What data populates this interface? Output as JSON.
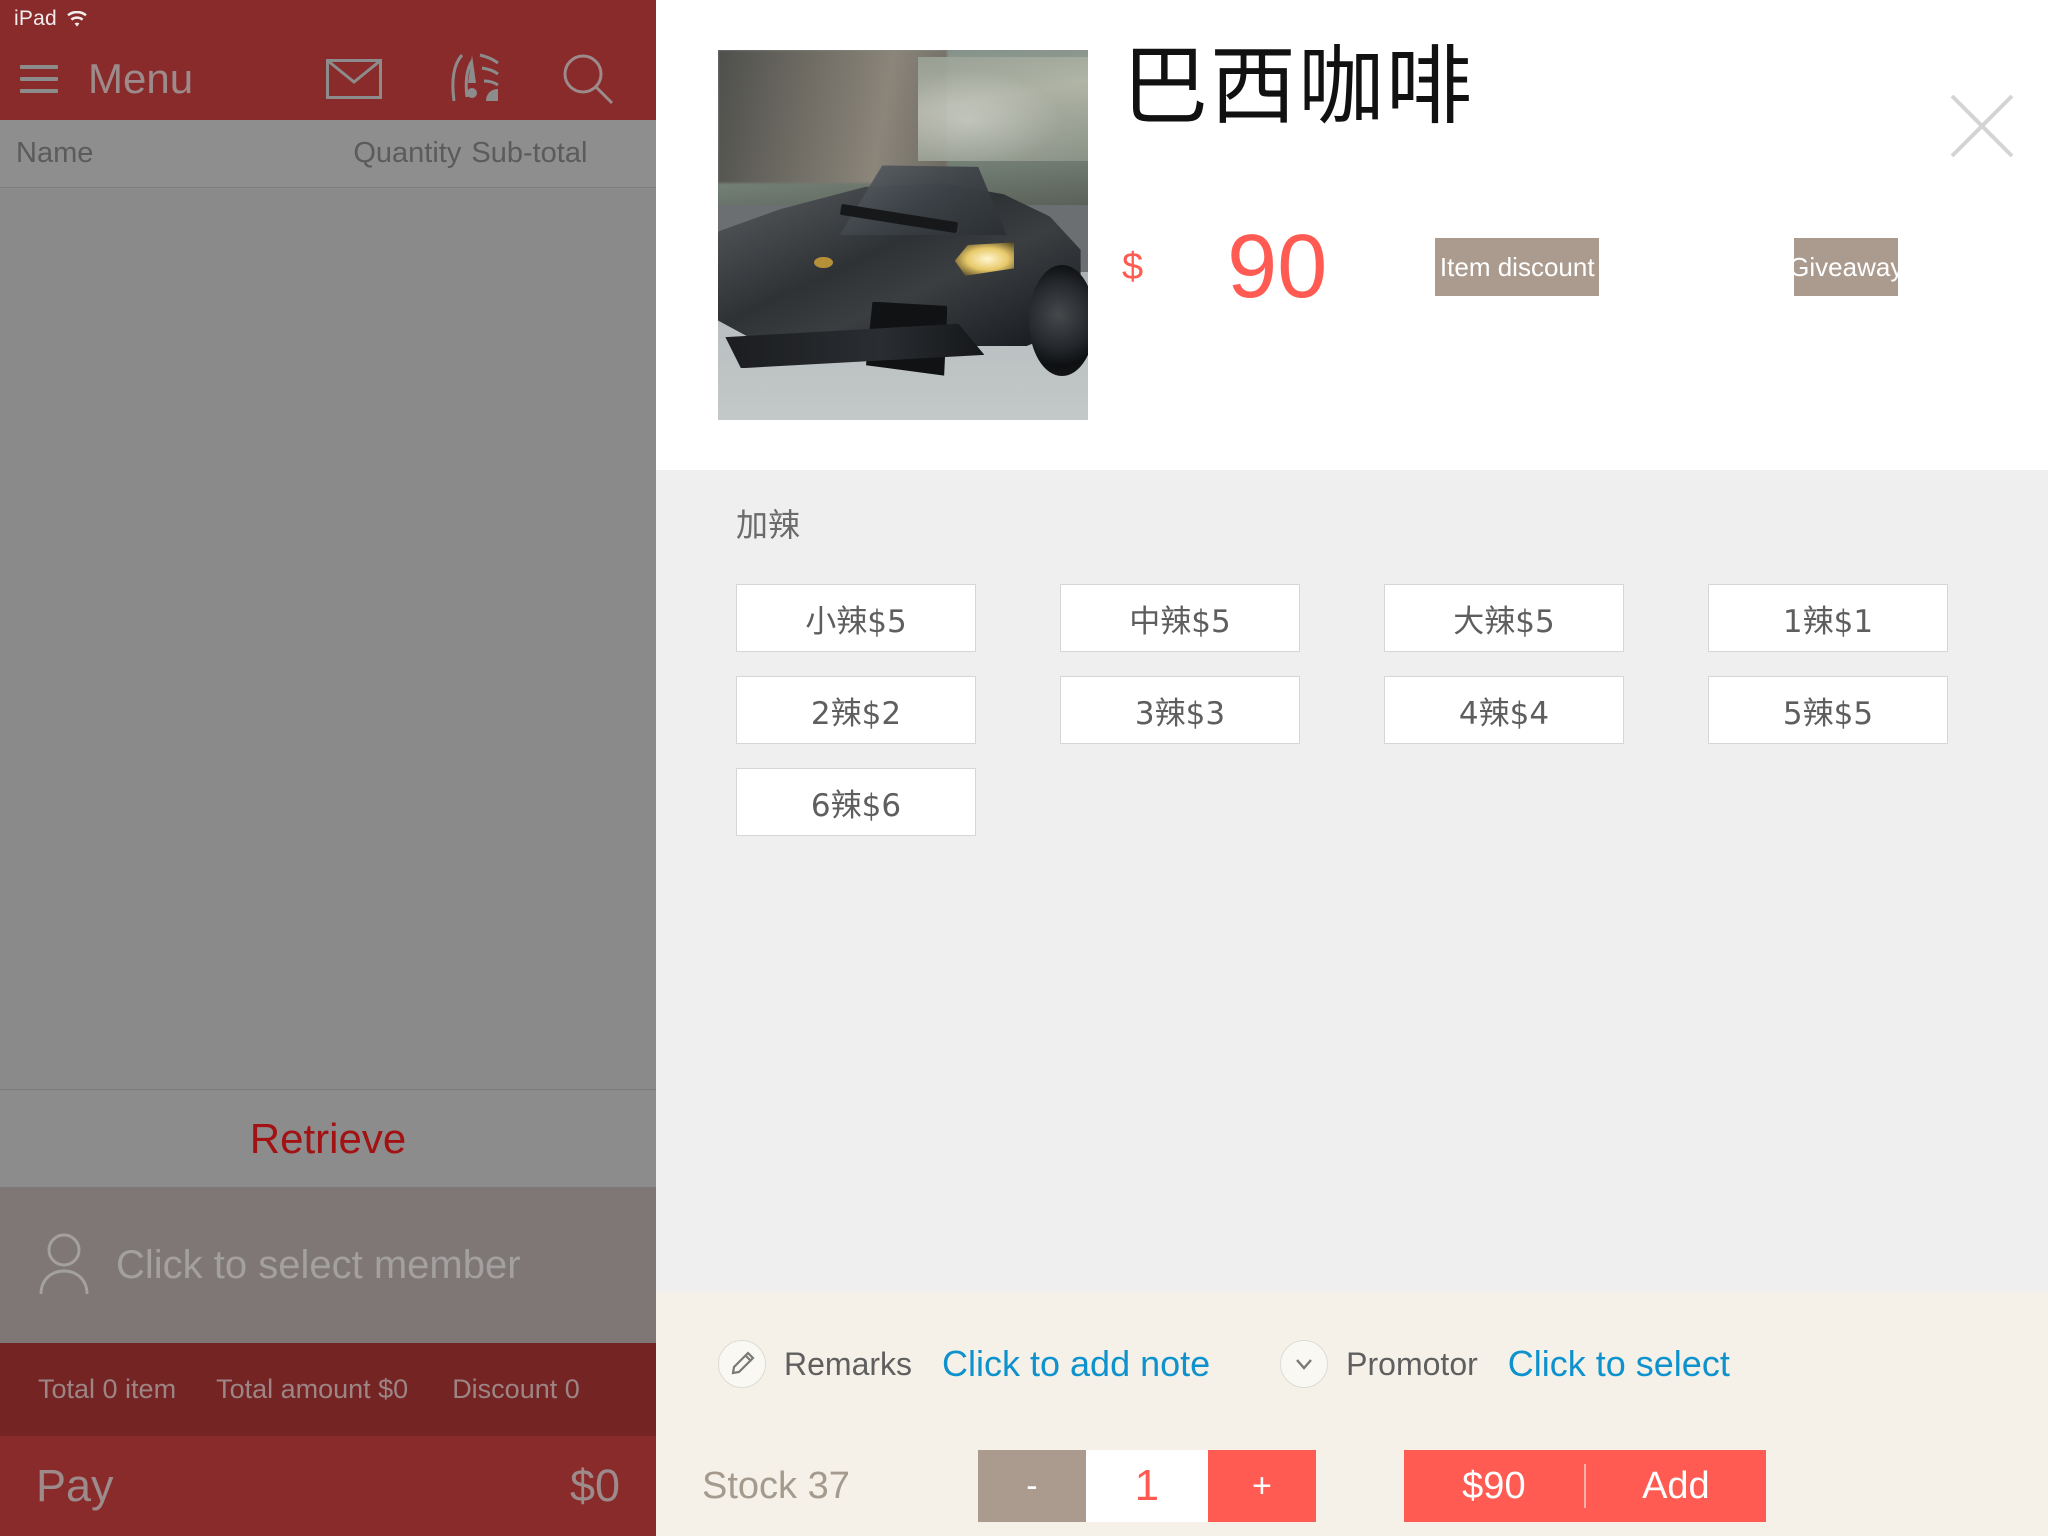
{
  "status_bar": {
    "device": "iPad",
    "wifi_icon": "wifi-icon"
  },
  "nav": {
    "menu_icon": "hamburger-icon",
    "title": "Menu",
    "icons": [
      "mail-icon",
      "notification-alert-icon",
      "search-icon"
    ]
  },
  "cart": {
    "columns": {
      "name": "Name",
      "quantity": "Quantity",
      "subtotal": "Sub-total"
    },
    "rows": [],
    "retrieve_label": "Retrieve",
    "member": {
      "icon": "person-icon",
      "placeholder": "Click to select member"
    },
    "totals": {
      "item_count": "Total 0 item",
      "amount": "Total amount $0",
      "discount": "Discount 0"
    },
    "pay": {
      "label": "Pay",
      "amount": "$0"
    }
  },
  "modal": {
    "close_icon": "close-icon",
    "product": {
      "image_alt": "lamborghini-reventon-photo",
      "title": "巴西咖啡",
      "currency": "$",
      "price": "90",
      "item_discount_label": "Item discount",
      "giveaway_label": "Giveaway"
    },
    "option_groups": [
      {
        "title": "加辣",
        "options": [
          {
            "label": "小辣$5"
          },
          {
            "label": "中辣$5"
          },
          {
            "label": "大辣$5"
          },
          {
            "label": "1辣$1"
          },
          {
            "label": "2辣$2"
          },
          {
            "label": "3辣$3"
          },
          {
            "label": "4辣$4"
          },
          {
            "label": "5辣$5"
          },
          {
            "label": "6辣$6"
          }
        ]
      }
    ],
    "remarks": {
      "icon": "pencil-icon",
      "label": "Remarks",
      "link": "Click to add note"
    },
    "promotor": {
      "icon": "chevron-down-icon",
      "label": "Promotor",
      "link": "Click to select"
    },
    "footer": {
      "stock": "Stock 37",
      "minus": "-",
      "quantity": "1",
      "plus": "+",
      "total_amount": "$90",
      "add_label": "Add"
    }
  },
  "colors": {
    "brand_red": "#8a2b2b",
    "accent_coral": "#ff5b52",
    "taupe": "#ab9b8f",
    "link_blue": "#0e92cd",
    "panel_cream": "#f5f1e8",
    "options_gray": "#efefef",
    "retrieve_red": "#a21212"
  }
}
